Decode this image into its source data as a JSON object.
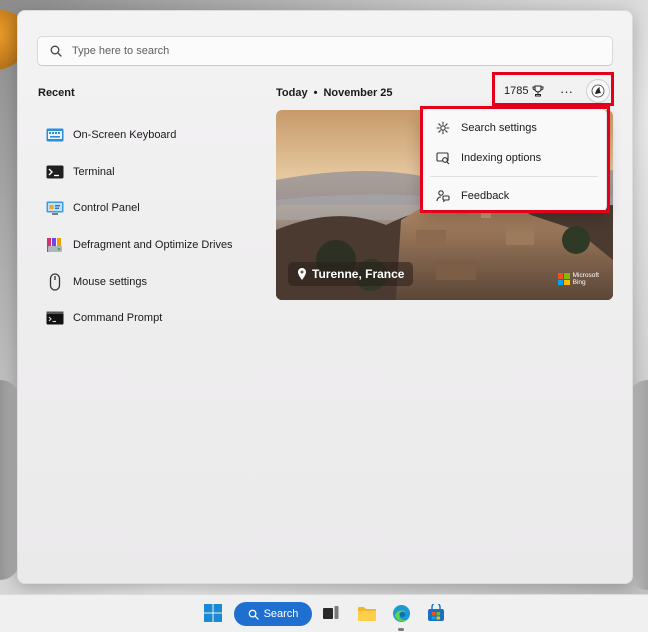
{
  "search": {
    "placeholder": "Type here to search"
  },
  "recent": {
    "heading": "Recent",
    "items": [
      {
        "label": "On-Screen Keyboard",
        "icon": "keyboard-icon"
      },
      {
        "label": "Terminal",
        "icon": "terminal-icon"
      },
      {
        "label": "Control Panel",
        "icon": "control-panel-icon"
      },
      {
        "label": "Defragment and Optimize Drives",
        "icon": "defrag-icon"
      },
      {
        "label": "Mouse settings",
        "icon": "mouse-icon"
      },
      {
        "label": "Command Prompt",
        "icon": "command-prompt-icon"
      }
    ]
  },
  "today": {
    "label": "Today",
    "separator": "•",
    "date": "November 25"
  },
  "toolbar": {
    "points": "1785",
    "more": "···",
    "points_icon": "trophy-icon",
    "avatar_icon": "avatar-icon"
  },
  "hero": {
    "location": "Turenne, France",
    "brand_line1": "Microsoft",
    "brand_line2": "Bing"
  },
  "menu": {
    "items": [
      {
        "label": "Search settings",
        "icon": "gear-icon"
      },
      {
        "label": "Indexing options",
        "icon": "indexing-icon"
      },
      {
        "label": "Feedback",
        "icon": "feedback-icon"
      }
    ]
  },
  "taskbar": {
    "search_label": "Search"
  },
  "colors": {
    "accent": "#1e6fd0",
    "highlight": "#e4001b"
  }
}
